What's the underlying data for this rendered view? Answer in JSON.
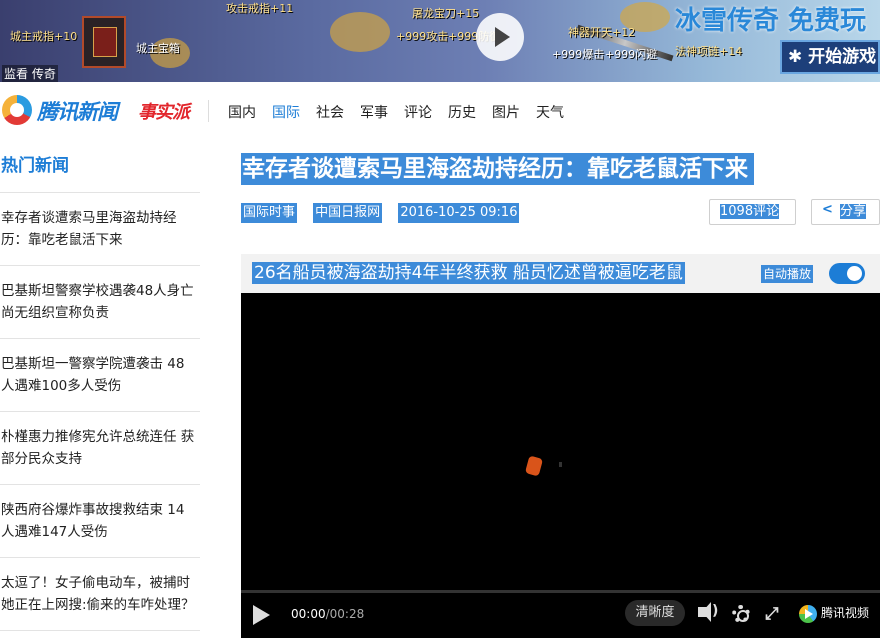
{
  "ad_banner": {
    "items": [
      {
        "text": "城主戒指+10"
      },
      {
        "text": "城主宝箱"
      },
      {
        "text": "攻击戒指+11"
      },
      {
        "text": "屠龙宝刀+15"
      },
      {
        "text": "+999攻击"
      },
      {
        "text": "+999防御"
      },
      {
        "text": "神器开天+12"
      },
      {
        "text": "+999爆击"
      },
      {
        "text": "+999闪避"
      },
      {
        "text": "法神项链+14"
      }
    ],
    "game_title": "冰雪传奇 免费玩",
    "start_button": "开始游戏",
    "supervise_label": "监看",
    "supervise_extra": "传奇"
  },
  "header": {
    "logo_text": "腾讯新闻",
    "logo_sub": "事实派",
    "nav": [
      {
        "label": "国内",
        "active": false
      },
      {
        "label": "国际",
        "active": true
      },
      {
        "label": "社会",
        "active": false
      },
      {
        "label": "军事",
        "active": false
      },
      {
        "label": "评论",
        "active": false
      },
      {
        "label": "历史",
        "active": false
      },
      {
        "label": "图片",
        "active": false
      },
      {
        "label": "天气",
        "active": false
      }
    ]
  },
  "sidebar": {
    "title": "热门新闻",
    "items": [
      {
        "text": "幸存者谈遭索马里海盗劫持经历：靠吃老鼠活下来"
      },
      {
        "text": "巴基斯坦警察学校遇袭48人身亡 尚无组织宣称负责"
      },
      {
        "text": "巴基斯坦一警察学院遭袭击 48人遇难100多人受伤"
      },
      {
        "text": "朴槿惠力推修宪允许总统连任 获部分民众支持"
      },
      {
        "text": "陕西府谷爆炸事故搜救结束 14人遇难147人受伤"
      },
      {
        "text": "太逗了！女子偷电动车，被捕时她正在上网搜:偷来的车咋处理？"
      }
    ]
  },
  "article": {
    "title": "幸存者谈遭索马里海盗劫持经历：靠吃老鼠活下来",
    "category": "国际时事",
    "source": "中国日报网",
    "datetime": "2016-10-25 09:16",
    "comment_count": "1098",
    "comment_label": "评论",
    "share_label": "分享"
  },
  "video": {
    "title": "26名船员被海盗劫持4年半终获救 船员忆述曾被逼吃老鼠",
    "autoplay_label": "自动播放",
    "autoplay_on": true,
    "current_time": "00:00",
    "duration": "/00:28",
    "quality_label": "清晰度",
    "brand_label": "腾讯视频",
    "progress": 0
  }
}
